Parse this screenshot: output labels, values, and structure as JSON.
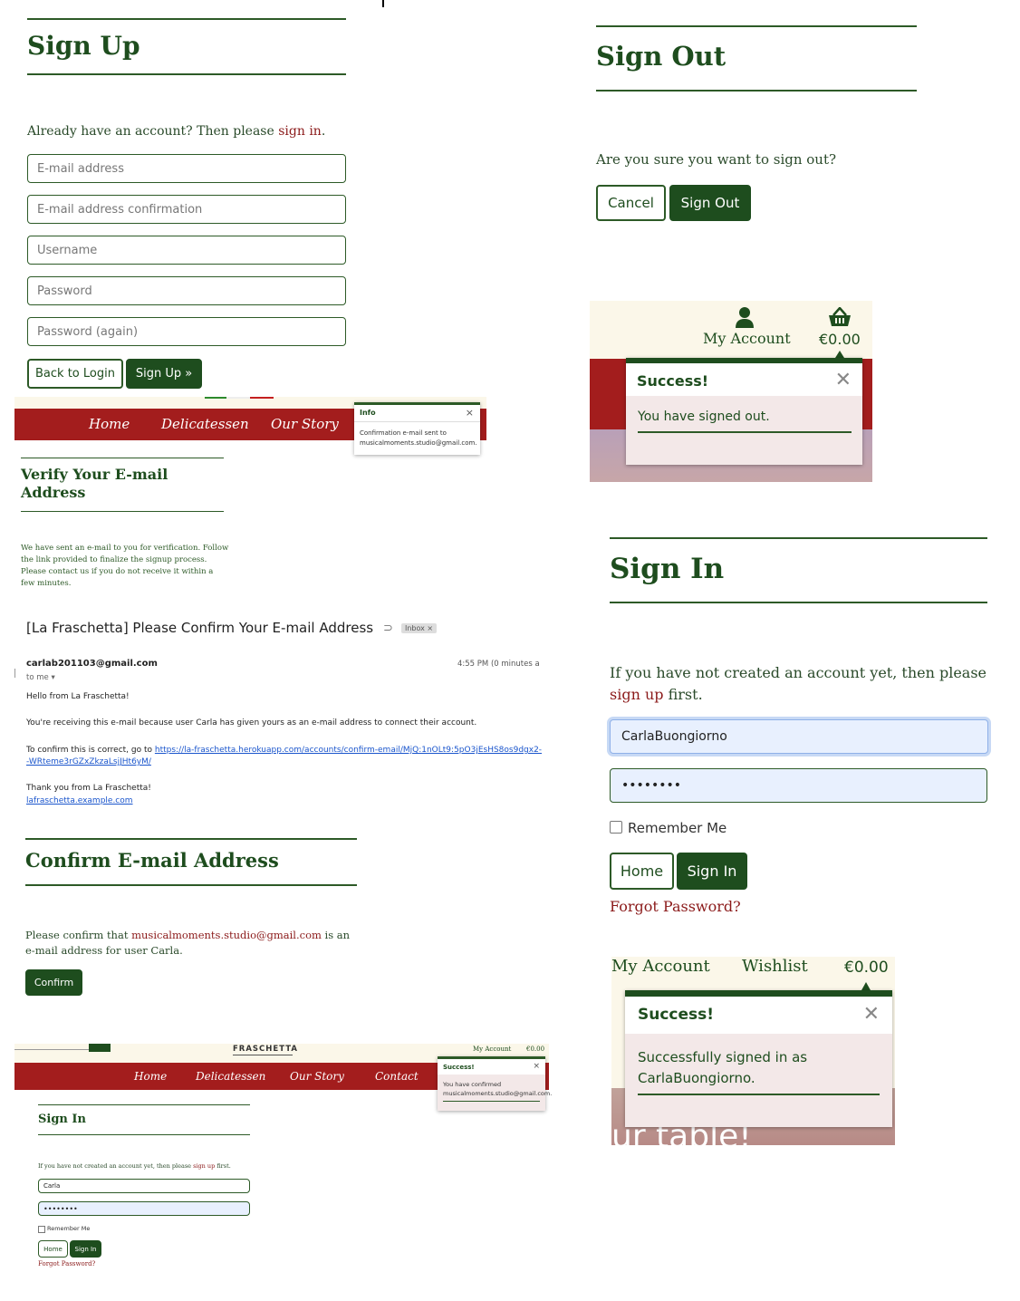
{
  "signup": {
    "title": "Sign Up",
    "prompt_text": "Already have an account? Then please ",
    "prompt_link": "sign in",
    "prompt_end": ".",
    "email_placeholder": "E-mail address",
    "email_confirm_placeholder": "E-mail address confirmation",
    "username_placeholder": "Username",
    "password_placeholder": "Password",
    "password_again_placeholder": "Password (again)",
    "back_button": "Back to Login",
    "submit_button": "Sign Up »"
  },
  "nav_info": {
    "items": [
      "Home",
      "Delicatessen",
      "Our Story"
    ],
    "toast_title": "Info",
    "toast_body": "Confirmation e-mail sent to musicalmoments.studio@gmail.com."
  },
  "verify": {
    "title": "Verify Your E-mail Address",
    "body": "We have sent an e-mail to you for verification. Follow the link provided to finalize the signup process. Please contact us if you do not receive it within a few minutes."
  },
  "email": {
    "subject": "[La Fraschetta] Please Confirm Your E-mail Address",
    "badge": "Inbox ×",
    "sender": "carlab201103@gmail.com",
    "time": "4:55 PM (0 minutes a",
    "to": "to me",
    "greeting": "Hello from La Fraschetta!",
    "line1": "You're receiving this e-mail because user Carla has given yours as an e-mail address to connect their account.",
    "line2_prefix": "To confirm this is correct, go to ",
    "line2_link": "https://la-fraschetta.herokuapp.com/accounts/confirm-email/MjQ:1nOLt9:5pO3jEsHS8os9dgx2--WRteme3rGZxZkzaLsjJHt6yM/",
    "thanks": "Thank you from La Fraschetta!",
    "site_link": "lafraschetta.example.com"
  },
  "confirm": {
    "title": "Confirm E-mail Address",
    "text_a": "Please confirm that ",
    "email_link": "musicalmoments.studio@gmail.com",
    "text_b": " is an e-mail address for user Carla.",
    "button": "Confirm"
  },
  "small_page": {
    "brand": "FRASCHETTA",
    "account": "My Account",
    "total": "€0.00",
    "nav_items": [
      "Home",
      "Delicatessen",
      "Our Story",
      "Contact"
    ],
    "toast_title": "Success!",
    "toast_body": "You have confirmed musicalmoments.studio@gmail.com.",
    "signin_title": "Sign In",
    "prompt_a": "If you have not created an account yet, then please ",
    "prompt_link": "sign up",
    "prompt_b": " first.",
    "username_value": "Carla",
    "password_value": "••••••••",
    "remember": "Remember Me",
    "home_button": "Home",
    "signin_button": "Sign In",
    "forgot": "Forgot Password?"
  },
  "signout": {
    "title": "Sign Out",
    "question": "Are you sure you want to sign out?",
    "cancel_button": "Cancel",
    "signout_button": "Sign Out"
  },
  "signout_toast": {
    "account": "My Account",
    "total": "€0.00",
    "title": "Success!",
    "message": "You have signed out."
  },
  "signin": {
    "title": "Sign In",
    "prompt_a": "If you have not created an account yet, then please ",
    "prompt_link": "sign up",
    "prompt_b": " first.",
    "username_value": "CarlaBuongiorno",
    "password_value": "••••••••",
    "remember": "Remember Me",
    "home_button": "Home",
    "signin_button": "Sign In",
    "forgot": "Forgot Password?"
  },
  "signin_toast": {
    "account": "My Account",
    "wishlist": "Wishlist",
    "total": "€0.00",
    "title": "Success!",
    "message": "Successfully signed in as CarlaBuongiorno.",
    "bg_text": "ur table!"
  }
}
